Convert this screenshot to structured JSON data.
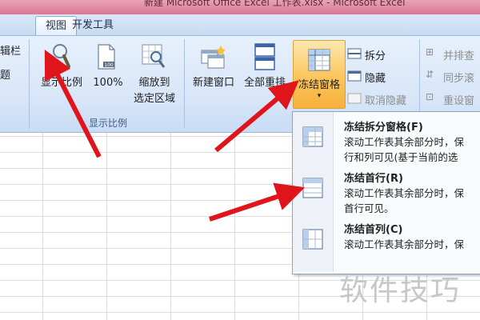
{
  "window": {
    "title": "新建 Microsoft Office Excel 工作表.xlsx - Microsoft Excel"
  },
  "tabs": [
    {
      "label": "视图"
    },
    {
      "label": "开发工具"
    }
  ],
  "ribbon": {
    "left_cut": {
      "line1": "辑栏",
      "line2": "题"
    },
    "zoom_group": {
      "label": "显示比例",
      "zoom_button": "显示比例",
      "hundred_button": "100%",
      "fit_selection_line1": "缩放到",
      "fit_selection_line2": "选定区域"
    },
    "window_group": {
      "new_window": "新建窗口",
      "arrange_all": "全部重排",
      "freeze_panes": "冻结窗格",
      "split": "拆分",
      "hide": "隐藏",
      "unhide": "取消隐藏",
      "side_by_side": "并排查",
      "sync_scroll": "同步滚",
      "reset_position": "重设窗"
    }
  },
  "dropdown": {
    "items": [
      {
        "title": "冻结拆分窗格(F)",
        "desc_line1": "滚动工作表其余部分时，保",
        "desc_line2": "行和列可见(基于当前的选"
      },
      {
        "title": "冻结首行(R)",
        "desc_line1": "滚动工作表其余部分时，保",
        "desc_line2": "首行可见。"
      },
      {
        "title": "冻结首列(C)",
        "desc_line1": "滚动工作表其余部分时，保",
        "desc_line2": ""
      }
    ]
  },
  "watermark": "软件技巧",
  "colors": {
    "arrow": "#e0141b",
    "highlight": "#fbc55a",
    "ribbon": "#d6e5f8"
  }
}
